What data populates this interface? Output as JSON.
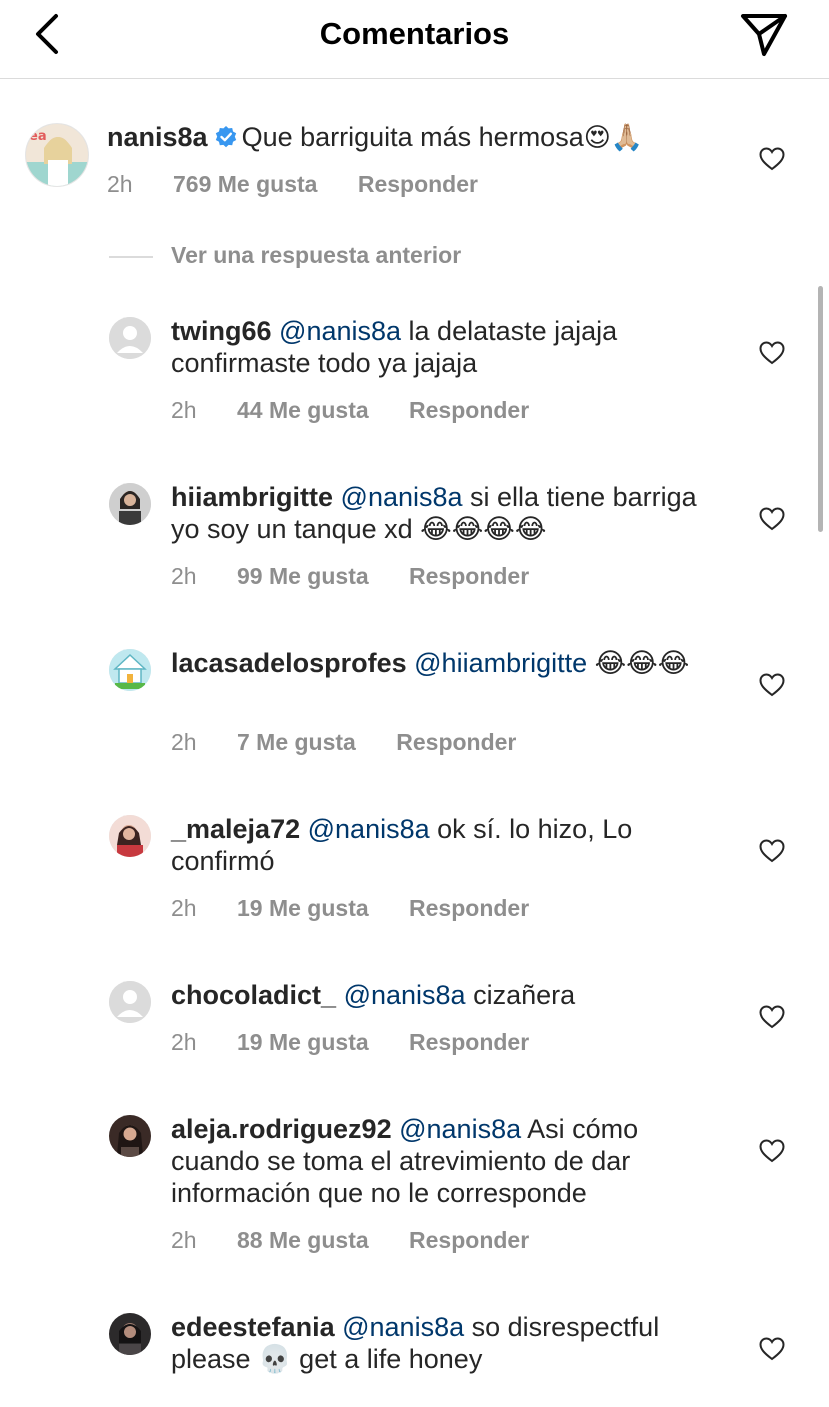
{
  "header": {
    "title": "Comentarios",
    "back_icon": "chevron-left-icon",
    "send_icon": "paper-plane-icon"
  },
  "main_comment": {
    "username": "nanis8a",
    "verified": true,
    "text": "Que barriguita más hermosa",
    "emoji": "😍🙏🏼",
    "time": "2h",
    "likes": "769 Me gusta",
    "reply": "Responder"
  },
  "previous_replies_label": "Ver una respuesta anterior",
  "replies": [
    {
      "username": "twing66",
      "mention": "@nanis8a",
      "text": "  la delataste jajaja confirmaste todo ya jajaja",
      "time": "2h",
      "likes": "44 Me gusta",
      "reply": "Responder"
    },
    {
      "username": "hiiambrigitte",
      "mention": "@nanis8a",
      "text": " si ella tiene barriga yo soy un tanque xd 😂😂😂😂",
      "time": "2h",
      "likes": "99 Me gusta",
      "reply": "Responder"
    },
    {
      "username": "lacasadelosprofes",
      "mention": "@hiiambrigitte",
      "text": " 😂😂😂",
      "time": "2h",
      "likes": "7 Me gusta",
      "reply": "Responder"
    },
    {
      "username": "_maleja72",
      "mention": "@nanis8a",
      "text": " ok sí. lo hizo, Lo confirmó",
      "time": "2h",
      "likes": "19 Me gusta",
      "reply": "Responder"
    },
    {
      "username": "chocoladict_",
      "mention": "@nanis8a",
      "text": " cizañera",
      "time": "2h",
      "likes": "19 Me gusta",
      "reply": "Responder"
    },
    {
      "username": "aleja.rodriguez92",
      "mention": "@nanis8a",
      "text": " Asi cómo cuando se toma el atrevimiento de dar información que no le corresponde",
      "time": "2h",
      "likes": "88 Me gusta",
      "reply": "Responder"
    },
    {
      "username": "edeestefania",
      "mention": "@nanis8a",
      "text": " so disrespectful please 💀 get a life honey",
      "time": "",
      "likes": "",
      "reply": ""
    }
  ],
  "colors": {
    "mention": "#00376b",
    "meta": "#8e8e8e",
    "verified": "#3897f0"
  }
}
